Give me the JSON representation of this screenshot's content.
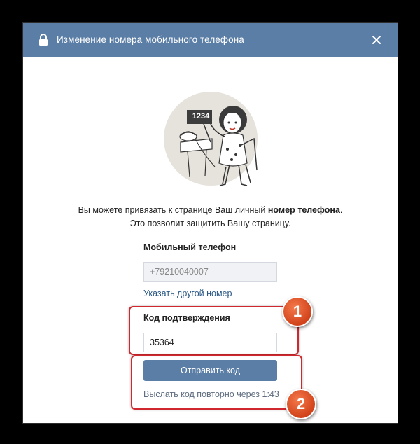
{
  "dialog": {
    "title": "Изменение номера мобильного телефона",
    "description_part1": "Вы можете привязать к странице Ваш личный ",
    "description_bold": "номер телефона",
    "description_part2": ".",
    "description_line2": "Это позволит защитить Вашу страницу."
  },
  "illustration": {
    "sign_text": "1234"
  },
  "phone": {
    "label": "Мобильный телефон",
    "value": "+79210040007",
    "change_link": "Указать другой номер"
  },
  "code": {
    "label": "Код подтверждения",
    "value": "35364"
  },
  "actions": {
    "send_button": "Отправить код",
    "resend_text": "Выслать код повторно через 1:43"
  },
  "annotations": {
    "badge1": "1",
    "badge2": "2"
  },
  "colors": {
    "header": "#5b7ea6",
    "highlight": "#d0282e",
    "badge": "#e2552a"
  }
}
